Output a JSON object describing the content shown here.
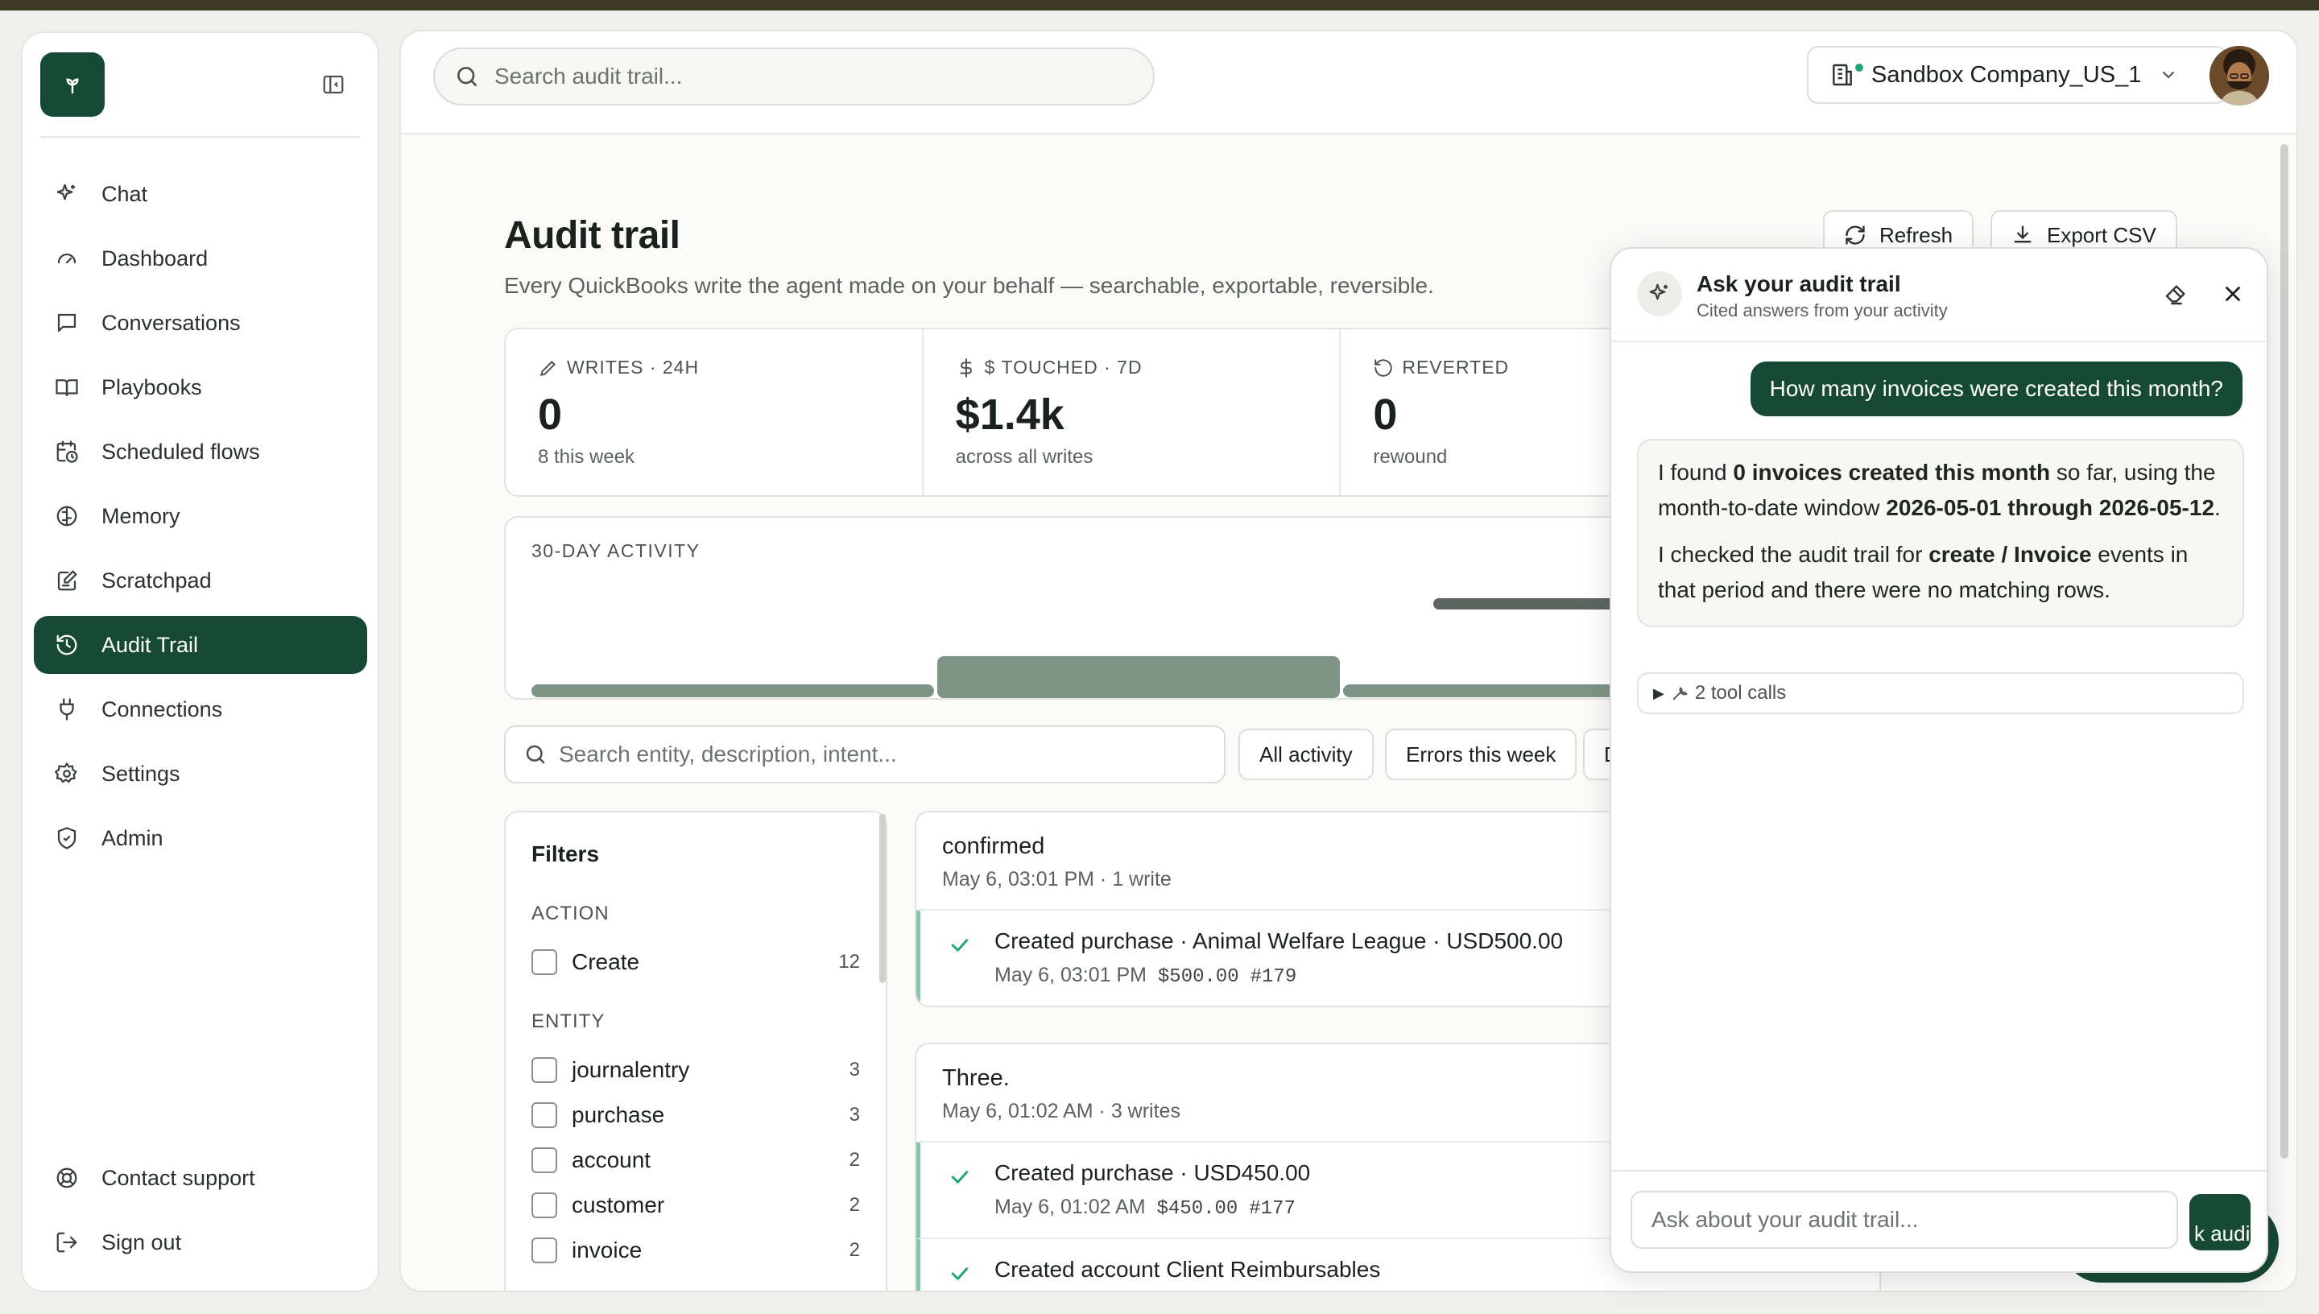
{
  "sidebar": {
    "items": [
      {
        "label": "Chat",
        "icon": "sparkle-icon"
      },
      {
        "label": "Dashboard",
        "icon": "gauge-icon"
      },
      {
        "label": "Conversations",
        "icon": "message-icon"
      },
      {
        "label": "Playbooks",
        "icon": "book-icon"
      },
      {
        "label": "Scheduled flows",
        "icon": "calendar-clock-icon"
      },
      {
        "label": "Memory",
        "icon": "brain-icon"
      },
      {
        "label": "Scratchpad",
        "icon": "notepad-icon"
      },
      {
        "label": "Audit Trail",
        "icon": "history-icon",
        "active": true
      },
      {
        "label": "Connections",
        "icon": "plug-icon"
      },
      {
        "label": "Settings",
        "icon": "gear-icon"
      },
      {
        "label": "Admin",
        "icon": "shield-icon"
      }
    ],
    "bottom": [
      {
        "label": "Contact support",
        "icon": "lifebuoy-icon"
      },
      {
        "label": "Sign out",
        "icon": "sign-out-icon"
      }
    ]
  },
  "topbar": {
    "search_placeholder": "Search audit trail...",
    "company": "Sandbox Company_US_1"
  },
  "page": {
    "title": "Audit trail",
    "subtitle": "Every QuickBooks write the agent made on your behalf — searchable, exportable, reversible.",
    "refresh_label": "Refresh",
    "export_label": "Export CSV"
  },
  "stats": [
    {
      "label": "WRITES · 24H",
      "value": "0",
      "sub": "8 this week",
      "icon": "pencil-icon"
    },
    {
      "label": "$ TOUCHED · 7D",
      "value": "$1.4k",
      "sub": "across all writes",
      "icon": "dollar-icon"
    },
    {
      "label": "REVERTED",
      "value": "0",
      "sub": "rewound",
      "icon": "undo-icon"
    }
  ],
  "activity": {
    "label": "30-DAY ACTIVITY"
  },
  "filter_bar": {
    "search_placeholder": "Search entity, description, intent...",
    "chips": [
      "All activity",
      "Errors this week",
      "D"
    ]
  },
  "filters": {
    "title": "Filters",
    "action_label": "ACTION",
    "actions": [
      {
        "label": "Create",
        "count": "12"
      }
    ],
    "entity_label": "ENTITY",
    "entities": [
      {
        "label": "journalentry",
        "count": "3"
      },
      {
        "label": "purchase",
        "count": "3"
      },
      {
        "label": "account",
        "count": "2"
      },
      {
        "label": "customer",
        "count": "2"
      },
      {
        "label": "invoice",
        "count": "2"
      }
    ]
  },
  "groups": [
    {
      "title": "confirmed",
      "meta": "May 6, 03:01 PM · 1 write",
      "entries": [
        {
          "title": "Created purchase · Animal Welfare League · USD500.00",
          "time": "May 6, 03:01 PM",
          "amount": "$500.00",
          "ref": "#179"
        }
      ]
    },
    {
      "title": "Three.",
      "meta": "May 6, 01:02 AM · 3 writes",
      "entries": [
        {
          "title": "Created purchase · USD450.00",
          "time": "May 6, 01:02 AM",
          "amount": "$450.00",
          "ref": "#177"
        },
        {
          "title": "Created account Client Reimbursables",
          "time": "",
          "amount": "",
          "ref": ""
        }
      ]
    }
  ],
  "chat": {
    "title": "Ask your audit trail",
    "subtitle": "Cited answers from your activity",
    "user_message": "How many invoices were created this month?",
    "answer_p1_a": "I found ",
    "answer_p1_b": "0 invoices created this month",
    "answer_p1_c": " so far, using the month-to-date window ",
    "answer_p1_d": "2026-05-01 through 2026-05-12",
    "answer_p1_e": ".",
    "answer_p2_a": "I checked the audit trail for ",
    "answer_p2_b": "create / Invoice",
    "answer_p2_c": " events in that period and there were no matching rows.",
    "tool_calls": "2 tool calls",
    "input_placeholder": "Ask about your audit trail...",
    "send_peek": "k audit"
  },
  "colors": {
    "brand": "#174a35",
    "accent_green": "#1fa774",
    "bar": "#7d9486"
  }
}
